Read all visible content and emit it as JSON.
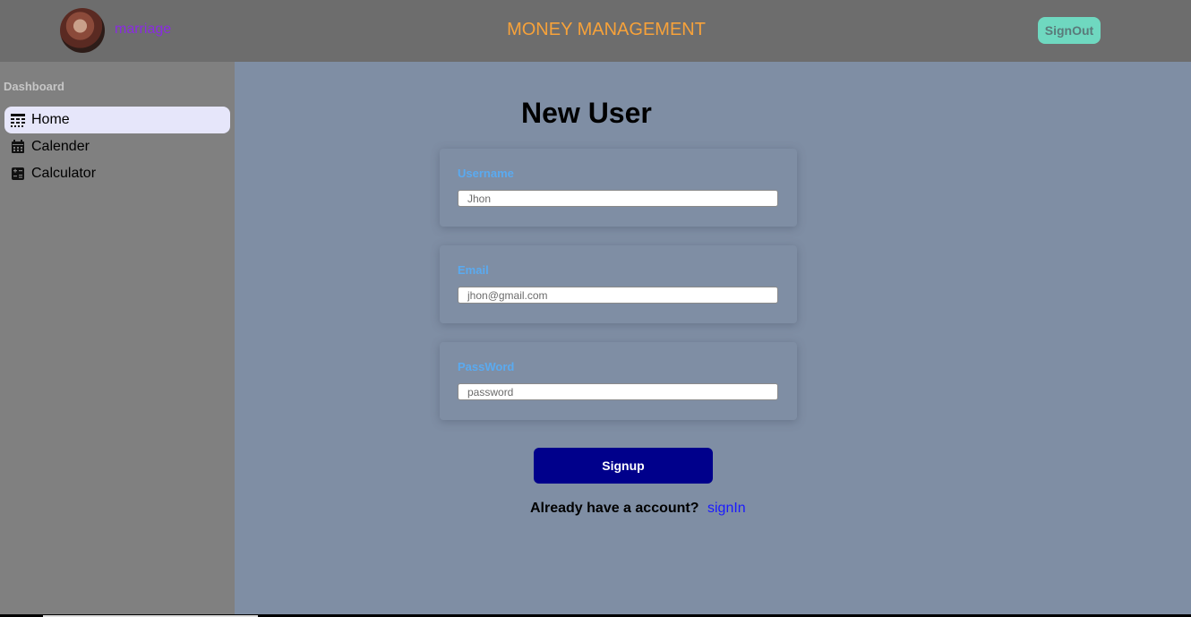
{
  "header": {
    "brand_name": "marriage",
    "app_title": "MONEY MANAGEMENT",
    "signout_label": "SignOut"
  },
  "sidebar": {
    "heading": "Dashboard",
    "items": [
      {
        "label": "Home",
        "icon": "table-rows-icon",
        "active": true
      },
      {
        "label": "Calender",
        "icon": "calendar-icon",
        "active": false
      },
      {
        "label": "Calculator",
        "icon": "calculator-icon",
        "active": false
      }
    ]
  },
  "form": {
    "title": "New User",
    "username": {
      "label": "Username",
      "placeholder": "Jhon"
    },
    "email": {
      "label": "Email",
      "placeholder": "jhon@gmail.com"
    },
    "password": {
      "label": "PassWord",
      "placeholder": "password"
    },
    "submit_label": "Signup",
    "account_prompt": "Already have a account?",
    "signin_label": "signIn"
  },
  "colors": {
    "topbar": "#6d6d6d",
    "sidebar": "#808080",
    "main_bg": "#7f8ea4",
    "title_accent": "#f7a23a",
    "brand": "#8a2be2",
    "signout_bg": "#6fd8c0",
    "active_nav": "#e6e6fa",
    "label_blue": "#5aaaf0",
    "signup_bg": "#00008b",
    "link": "#1a1aff"
  }
}
